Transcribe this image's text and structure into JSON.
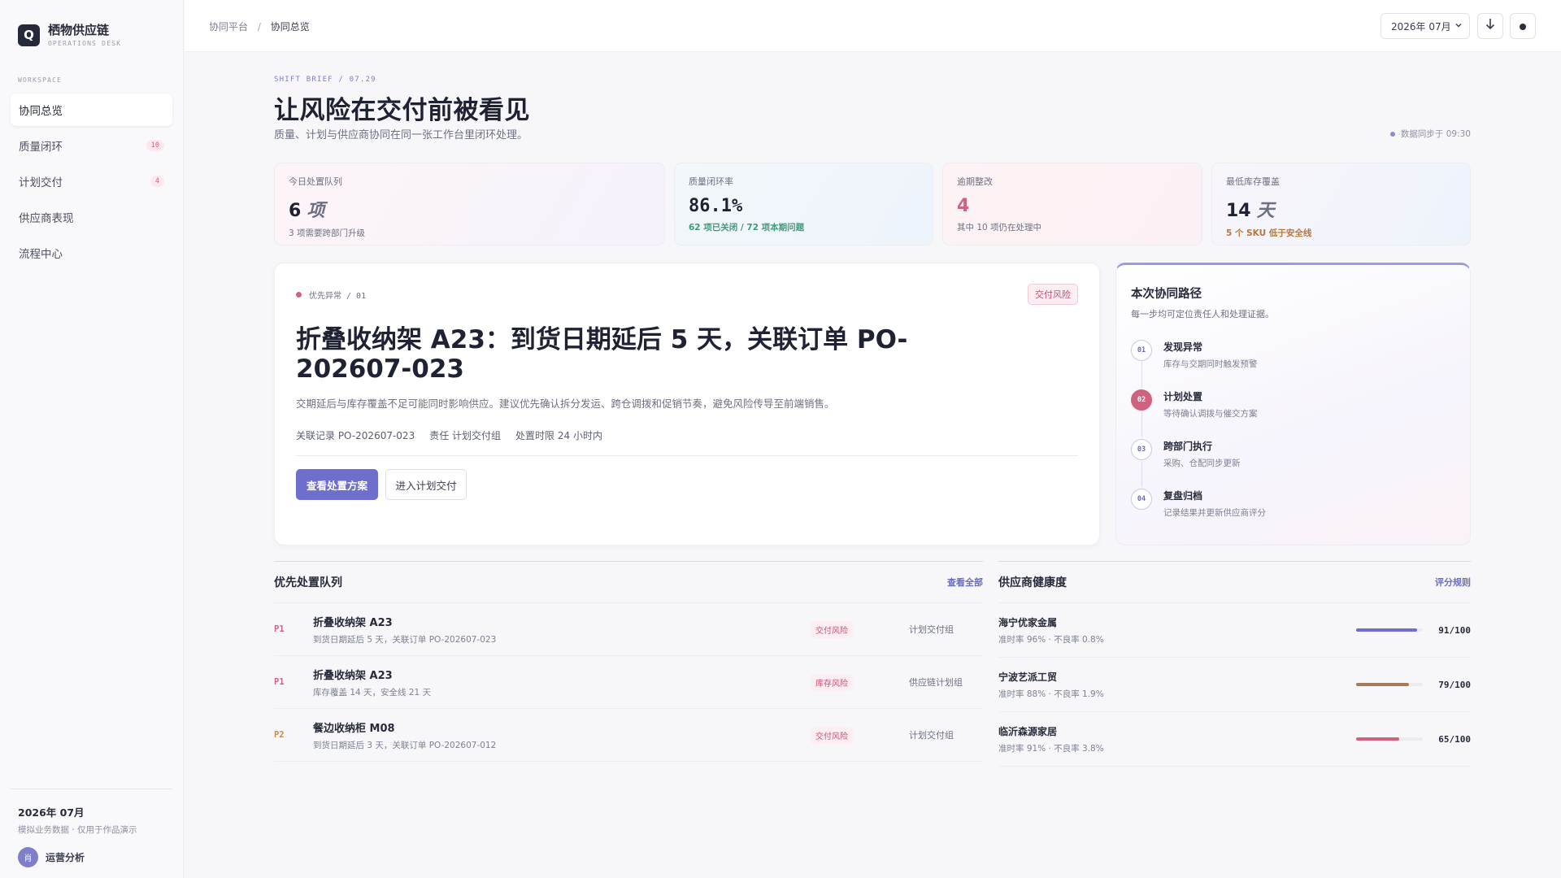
{
  "brand": {
    "logo": "Q",
    "name": "栖物供应链",
    "sub": "OPERATIONS DESK"
  },
  "sidebar": {
    "section": "WORKSPACE",
    "items": [
      {
        "label": "协同总览",
        "badge": ""
      },
      {
        "label": "质量闭环",
        "badge": "10"
      },
      {
        "label": "计划交付",
        "badge": "4"
      },
      {
        "label": "供应商表现",
        "badge": ""
      },
      {
        "label": "流程中心",
        "badge": ""
      }
    ],
    "footer": {
      "month": "2026年 07月",
      "note": "模拟业务数据 · 仅用于作品演示",
      "avatar": "肖",
      "user": "运营分析"
    }
  },
  "topbar": {
    "breadcrumb": [
      "协同平台",
      "协同总览"
    ],
    "month_select": "2026年 07月",
    "download_icon": "download-icon",
    "theme_icon": "dot-icon"
  },
  "hero": {
    "eyebrow": "SHIFT BRIEF / 07.29",
    "title": "让风险在交付前被看见",
    "subtitle": "质量、计划与供应商协同在同一张工作台里闭环处理。",
    "sync": "数据同步于 09:30"
  },
  "kpis": [
    {
      "label": "今日处置队列",
      "value": "6",
      "unit": "项",
      "note": "3 项需要跨部门升级",
      "note_color": "#6d7083"
    },
    {
      "label": "质量闭环率",
      "value": "86.1%",
      "unit": "",
      "note": "62 项已关闭 / 72 项本期问题",
      "note_color": "#3e9b78"
    },
    {
      "label": "逾期整改",
      "value": "4",
      "unit": "",
      "note": "其中 10 项仍在处理中",
      "note_color": "#6d7083",
      "value_color": "#d0627f"
    },
    {
      "label": "最低库存覆盖",
      "value": "14",
      "unit": "天",
      "note": "5 个 SKU 低于安全线",
      "note_color": "#b8773a"
    }
  ],
  "focus": {
    "tag": "优先异常 / 01",
    "risk": "交付风险",
    "title": "折叠收纳架 A23：到货日期延后 5 天，关联订单 PO-202607-023",
    "desc": "交期延后与库存覆盖不足可能同时影响供应。建议优先确认拆分发运、跨仓调拨和促销节奏，避免风险传导至前端销售。",
    "meta": [
      "关联记录 PO-202607-023",
      "责任 计划交付组",
      "处置时限 24 小时内"
    ],
    "primary": "查看处置方案",
    "secondary": "进入计划交付"
  },
  "path": {
    "title": "本次协同路径",
    "subtitle": "每一步均可定位责任人和处理证据。",
    "steps": [
      {
        "num": "01",
        "title": "发现异常",
        "desc": "库存与交期同时触发预警"
      },
      {
        "num": "02",
        "title": "计划处置",
        "desc": "等待确认调拨与催交方案"
      },
      {
        "num": "03",
        "title": "跨部门执行",
        "desc": "采购、仓配同步更新"
      },
      {
        "num": "04",
        "title": "复盘归档",
        "desc": "记录结果并更新供应商评分"
      }
    ],
    "active_step": 1
  },
  "queue": {
    "title": "优先处置队列",
    "link": "查看全部",
    "rows": [
      {
        "prio": "P1",
        "title": "折叠收纳架 A23",
        "sub": "到货日期延后 5 天，关联订单 PO-202607-023",
        "tag": "交付风险",
        "owner": "计划交付组",
        "prio_color": "#d0627f"
      },
      {
        "prio": "P1",
        "title": "折叠收纳架 A23",
        "sub": "库存覆盖 14 天，安全线 21 天",
        "tag": "库存风险",
        "owner": "供应链计划组",
        "prio_color": "#d0627f"
      },
      {
        "prio": "P2",
        "title": "餐边收纳柜 M08",
        "sub": "到货日期延后 3 天，关联订单 PO-202607-012",
        "tag": "交付风险",
        "owner": "计划交付组",
        "prio_color": "#c98a4a"
      }
    ]
  },
  "suppliers": {
    "title": "供应商健康度",
    "link": "评分规则",
    "rows": [
      {
        "name": "海宁优家金属",
        "sub": "准时率 96% · 不良率 0.8%",
        "score": 91,
        "score_label": "91/100",
        "color": "#6e6fcd"
      },
      {
        "name": "宁波艺派工贸",
        "sub": "准时率 88% · 不良率 1.9%",
        "score": 79,
        "score_label": "79/100",
        "color": "#a87a5a"
      },
      {
        "name": "临沂森源家居",
        "sub": "准时率 91% · 不良率 3.8%",
        "score": 65,
        "score_label": "65/100",
        "color": "#d0627f"
      }
    ]
  }
}
